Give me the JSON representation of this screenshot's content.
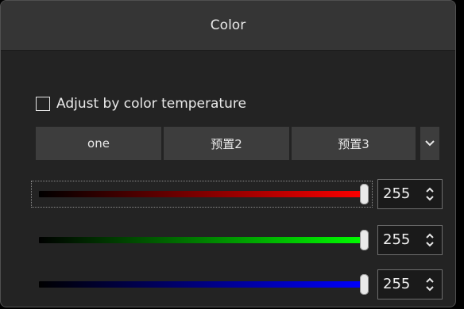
{
  "panel": {
    "title": "Color"
  },
  "adjust": {
    "label": "Adjust by color temperature",
    "checked": false
  },
  "presets": {
    "buttons": [
      "one",
      "预置2",
      "预置3"
    ],
    "dropdown_icon": "chevron-down-icon"
  },
  "sliders": [
    {
      "channel": "red",
      "value": "255",
      "color": "#ff0000"
    },
    {
      "channel": "green",
      "value": "255",
      "color": "#00ff00"
    },
    {
      "channel": "blue",
      "value": "255",
      "color": "#0000ff"
    }
  ],
  "colors": {
    "panel_bg": "#232323",
    "titlebar_bg": "#353535",
    "button_bg": "#3d3d3d",
    "text": "#e8e8e8"
  }
}
